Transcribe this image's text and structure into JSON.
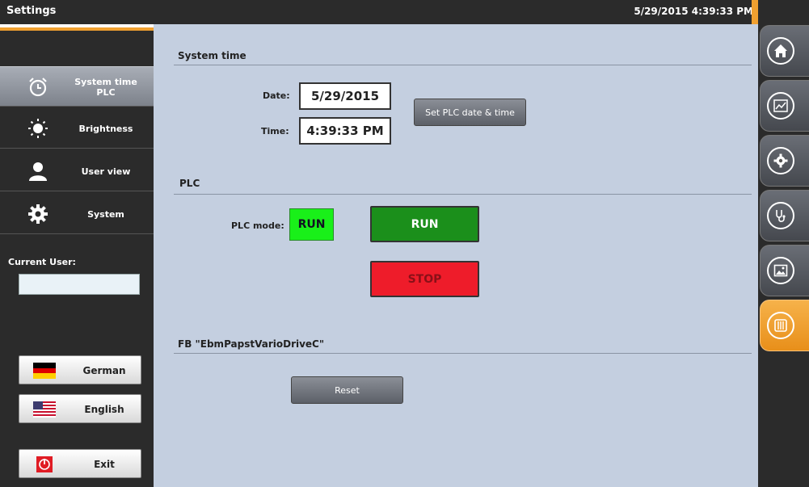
{
  "topbar": {
    "title": "Settings",
    "datetime": "5/29/2015 4:39:33 PM"
  },
  "sidebar": {
    "items": [
      {
        "label_line1": "System time",
        "label_line2": "PLC",
        "icon": "alarm-clock-icon",
        "active": true
      },
      {
        "label": "Brightness",
        "icon": "sun-icon"
      },
      {
        "label": "User view",
        "icon": "user-icon"
      },
      {
        "label": "System",
        "icon": "gear-icon"
      }
    ],
    "current_user_label": "Current User:",
    "current_user_value": "",
    "languages": [
      {
        "label": "German",
        "icon": "german-flag-icon"
      },
      {
        "label": "English",
        "icon": "us-flag-icon"
      }
    ],
    "exit_label": "Exit"
  },
  "system_time": {
    "title": "System time",
    "date_label": "Date:",
    "date_value": "5/29/2015",
    "time_label": "Time:",
    "time_value": "4:39:33 PM",
    "set_button": "Set PLC date & time"
  },
  "plc": {
    "title": "PLC",
    "mode_label": "PLC mode:",
    "mode_value": "RUN",
    "run_button": "RUN",
    "stop_button": "STOP"
  },
  "fb": {
    "title": "FB \"EbmPapstVarioDriveC\"",
    "reset_button": "Reset"
  },
  "rightnav": [
    {
      "icon": "home-icon"
    },
    {
      "icon": "chart-icon"
    },
    {
      "icon": "gear-icon"
    },
    {
      "icon": "stethoscope-icon"
    },
    {
      "icon": "image-icon"
    },
    {
      "icon": "equalizer-icon",
      "active": true
    }
  ],
  "colors": {
    "accent": "#f0a030",
    "panel": "#c4cfe0",
    "run_indicator": "#19f019",
    "run_button": "#1b8f1b",
    "stop_button": "#ee1c2a"
  }
}
